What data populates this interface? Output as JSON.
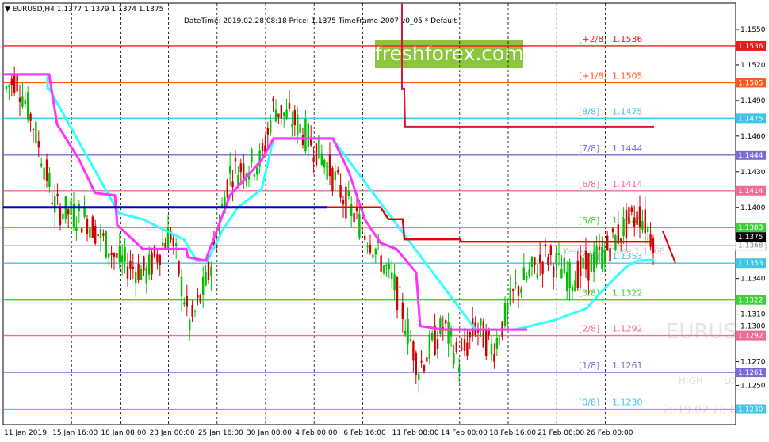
{
  "header": {
    "symbol": "EURUSD,H4",
    "ohlc": "1.1377 1.1379 1.1374 1.1375",
    "info": "DateTime: 2019.02.28 08:18    Price: 1.1375    TimeFrame-2007   v0_05    *   Default"
  },
  "watermark": {
    "text": "freshforex.com",
    "color": "#8cc63f"
  },
  "overlay": {
    "symbol": "EURUS",
    "high_label": "HIGH",
    "low_label": "LO",
    "date": "2019.02.28 0"
  },
  "chart_data": {
    "type": "line",
    "ylim": [
      1.1217,
      1.1572
    ],
    "y_ticks": [
      "1.1550",
      "1.1520",
      "1.1490",
      "1.1460",
      "1.1430",
      "1.1400",
      "1.1370",
      "1.1340",
      "1.1310",
      "1.1300",
      "1.1270",
      "1.1250"
    ],
    "x_ticks": [
      "11 Jan 2019",
      "15 Jan 16:00",
      "18 Jan 08:00",
      "23 Jan 00:00",
      "25 Jan 16:00",
      "30 Jan 08:00",
      "4 Feb 00:00",
      "6 Feb 16:00",
      "11 Feb 08:00",
      "14 Feb 00:00",
      "18 Feb 16:00",
      "21 Feb 08:00",
      "26 Feb 00:00"
    ],
    "murrey_levels": [
      {
        "label": "[+2/8]",
        "value": 1.1536,
        "color": "#e41e1e"
      },
      {
        "label": "[+1/8]",
        "value": 1.1505,
        "color": "#ff5a1e"
      },
      {
        "label": "[8/8]",
        "value": 1.1475,
        "color": "#3fc4ea"
      },
      {
        "label": "[7/8]",
        "value": 1.1444,
        "color": "#7a6cd6"
      },
      {
        "label": "[6/8]",
        "value": 1.1414,
        "color": "#ef6c9a"
      },
      {
        "label": "[5/8]",
        "value": 1.1383,
        "color": "#39d13a"
      },
      {
        "label": "[4/8]",
        "value": 1.1353,
        "color": "#3fc4ea"
      },
      {
        "label": "[3/8]",
        "value": 1.1322,
        "color": "#39d13a"
      },
      {
        "label": "[2/8]",
        "value": 1.1292,
        "color": "#ef6c9a"
      },
      {
        "label": "[1/8]",
        "value": 1.1261,
        "color": "#7a6cd6"
      },
      {
        "label": "[0/8]",
        "value": 1.123,
        "color": "#3fc4ea"
      }
    ],
    "current_price": {
      "label": "1.1375",
      "value": 1.1375
    },
    "grey_price": {
      "label": "1.1368",
      "value": 1.1368
    },
    "yesterday_close": {
      "label": "Yesterday Close 1.1368",
      "value": 1.1368
    },
    "colors": {
      "bull": "#00c000",
      "bear": "#d00000",
      "magenta": "#ff33ff",
      "cyan": "#33ffff",
      "red_line": "#e00000",
      "blue_line": "#0000cc",
      "crimson": "#dc143c"
    }
  }
}
